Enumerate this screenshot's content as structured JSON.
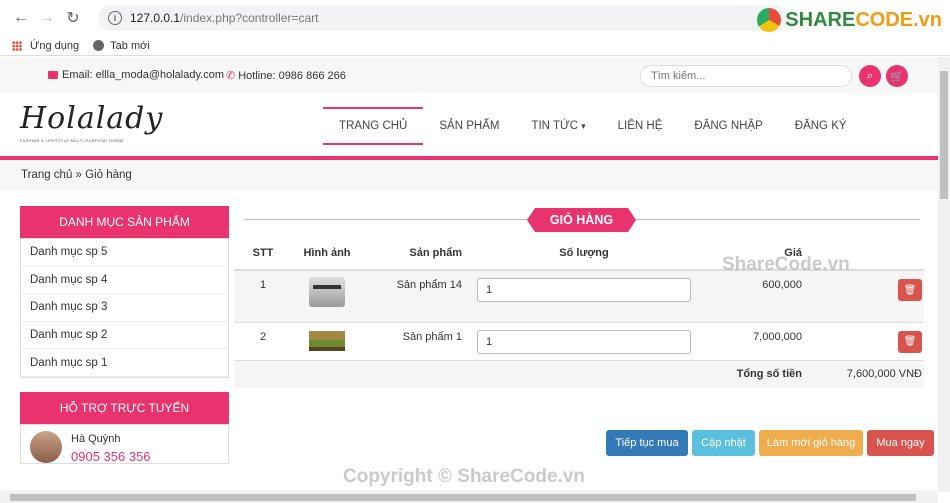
{
  "browser": {
    "url_host": "127.0.0.1",
    "url_path": "/index.php?controller=cart",
    "bookmarks": [
      "Ứng dụng",
      "Tab mới"
    ],
    "watermark_share": "SHARE",
    "watermark_code": "CODE.vn"
  },
  "topbar": {
    "email": "Email: ellla_moda@holalady.com",
    "hotline": "Hotline: 0986 866 266",
    "search_placeholder": "Tìm kiếm..."
  },
  "header": {
    "logo_text": "Holalady",
    "logo_tagline": "FASHION & LIFESTYLE MULTI-PURPOSE THEME",
    "nav": [
      "TRANG CHỦ",
      "SẢN PHẨM",
      "TIN TỨC",
      "LIÊN HỆ",
      "ĐĂNG NHẬP",
      "ĐĂNG KÝ"
    ]
  },
  "breadcrumb": "Trang chủ » Giỏ hàng",
  "sidebar": {
    "category_title": "DANH MỤC SẢN PHẨM",
    "categories": [
      "Danh mục sp 5",
      "Danh mục sp 4",
      "Danh mục sp 3",
      "Danh mục sp 2",
      "Danh mục sp 1"
    ],
    "support_title": "HỖ TRỢ TRỰC TUYẾN",
    "support_name": "Hà Quỳnh",
    "support_phone": "0905 356 356"
  },
  "cart": {
    "title": "GIỎ HÀNG",
    "columns": [
      "STT",
      "Hình ảnh",
      "Sản phẩm",
      "Số lượng",
      "Giá"
    ],
    "rows": [
      {
        "stt": "1",
        "product": "Sản phẩm 14",
        "qty": "1",
        "price": "600,000",
        "image": "printer"
      },
      {
        "stt": "2",
        "product": "Sản phẩm 1",
        "qty": "1",
        "price": "7,000,000",
        "image": "landscape"
      }
    ],
    "total_label": "Tổng số tiền",
    "total_value": "7,600,000 VNĐ"
  },
  "actions": {
    "continue": "Tiếp tục mua",
    "update": "Cập nhật",
    "reset": "Làm mới giỏ hàng",
    "buy": "Mua ngay"
  },
  "watermarks": {
    "center": "ShareCode.vn",
    "bottom": "Copyright © ShareCode.vn"
  },
  "colors": {
    "accent": "#e8336e",
    "blue": "#337ab7",
    "cyan": "#5bc0de",
    "orange": "#f0ad4e",
    "red": "#d9534f"
  }
}
